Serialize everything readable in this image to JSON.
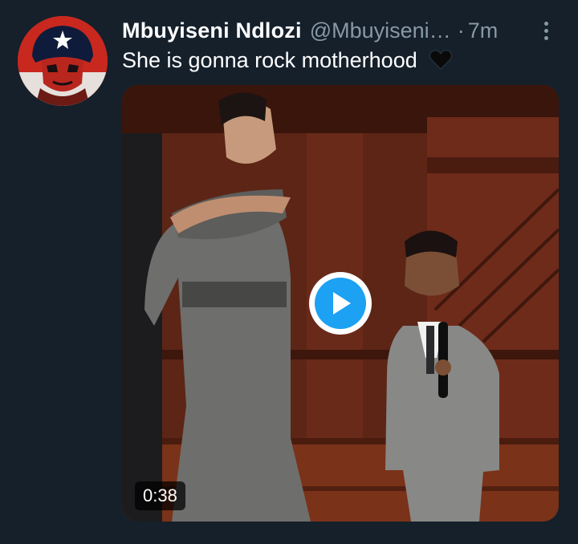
{
  "author": {
    "name": "Mbuyiseni Ndlozi",
    "handle": "@Mbuyiseni…",
    "separator": "·",
    "time": "7m"
  },
  "tweet": {
    "text": "She is gonna rock motherhood"
  },
  "media": {
    "duration": "0:38"
  },
  "icons": {
    "more": "more-vertical-icon",
    "heart": "black-heart-icon",
    "play": "play-icon"
  },
  "colors": {
    "background": "#15202b",
    "secondary_text": "#8899a6",
    "accent": "#1da1f2"
  }
}
